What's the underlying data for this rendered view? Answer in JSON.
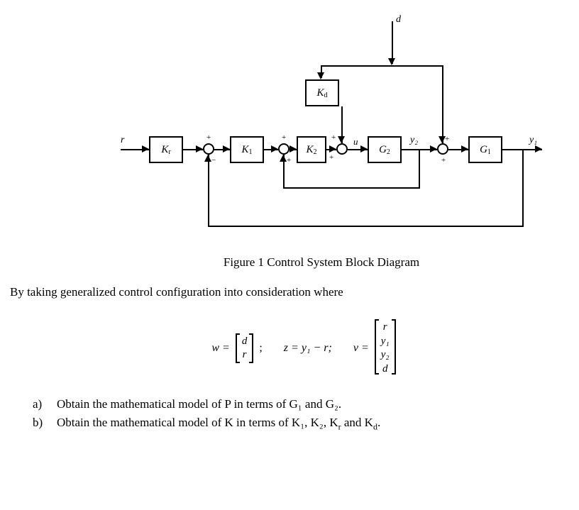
{
  "diagram": {
    "input_signal": "r",
    "disturbance_signal": "d",
    "intermediate_signal_u": "u",
    "intermediate_signal_y2": "y₂",
    "output_signal": "y₁",
    "blocks": {
      "Kr": "K",
      "Kr_sub": "r",
      "Kd": "K",
      "Kd_sub": "d",
      "K1": "K",
      "K1_sub": "1",
      "K2": "K",
      "K2_sub": "2",
      "G2": "G",
      "G2_sub": "2",
      "G1": "G",
      "G1_sub": "1"
    },
    "signs": {
      "sum1_top": "+",
      "sum1_bot": "−",
      "sum2_top": "+",
      "sum2_bot": "+",
      "sum3_left": "+",
      "sum3_top": "+",
      "sum4_top": "+",
      "sum4_bot": "+"
    }
  },
  "caption": "Figure 1 Control System Block Diagram",
  "description": "By taking generalized control configuration into consideration where",
  "math": {
    "w_eq": "w =",
    "w_d": "d",
    "w_r": "r",
    "z_eq": "z = y₁ − r;",
    "v_eq": "v =",
    "v_r": "r",
    "v_y1": "y₁",
    "v_y2": "y₂",
    "v_d": "d",
    "semicolon": ";"
  },
  "questions": {
    "a_letter": "a)",
    "a_text": "Obtain the mathematical model of P in terms of G₁ and G₂.",
    "b_letter": "b)",
    "b_text": "Obtain the mathematical model of K in terms of K₁, K₂, K",
    "b_text2": " and K",
    "b_sub_r": "r",
    "b_sub_d": "d",
    "period": "."
  }
}
